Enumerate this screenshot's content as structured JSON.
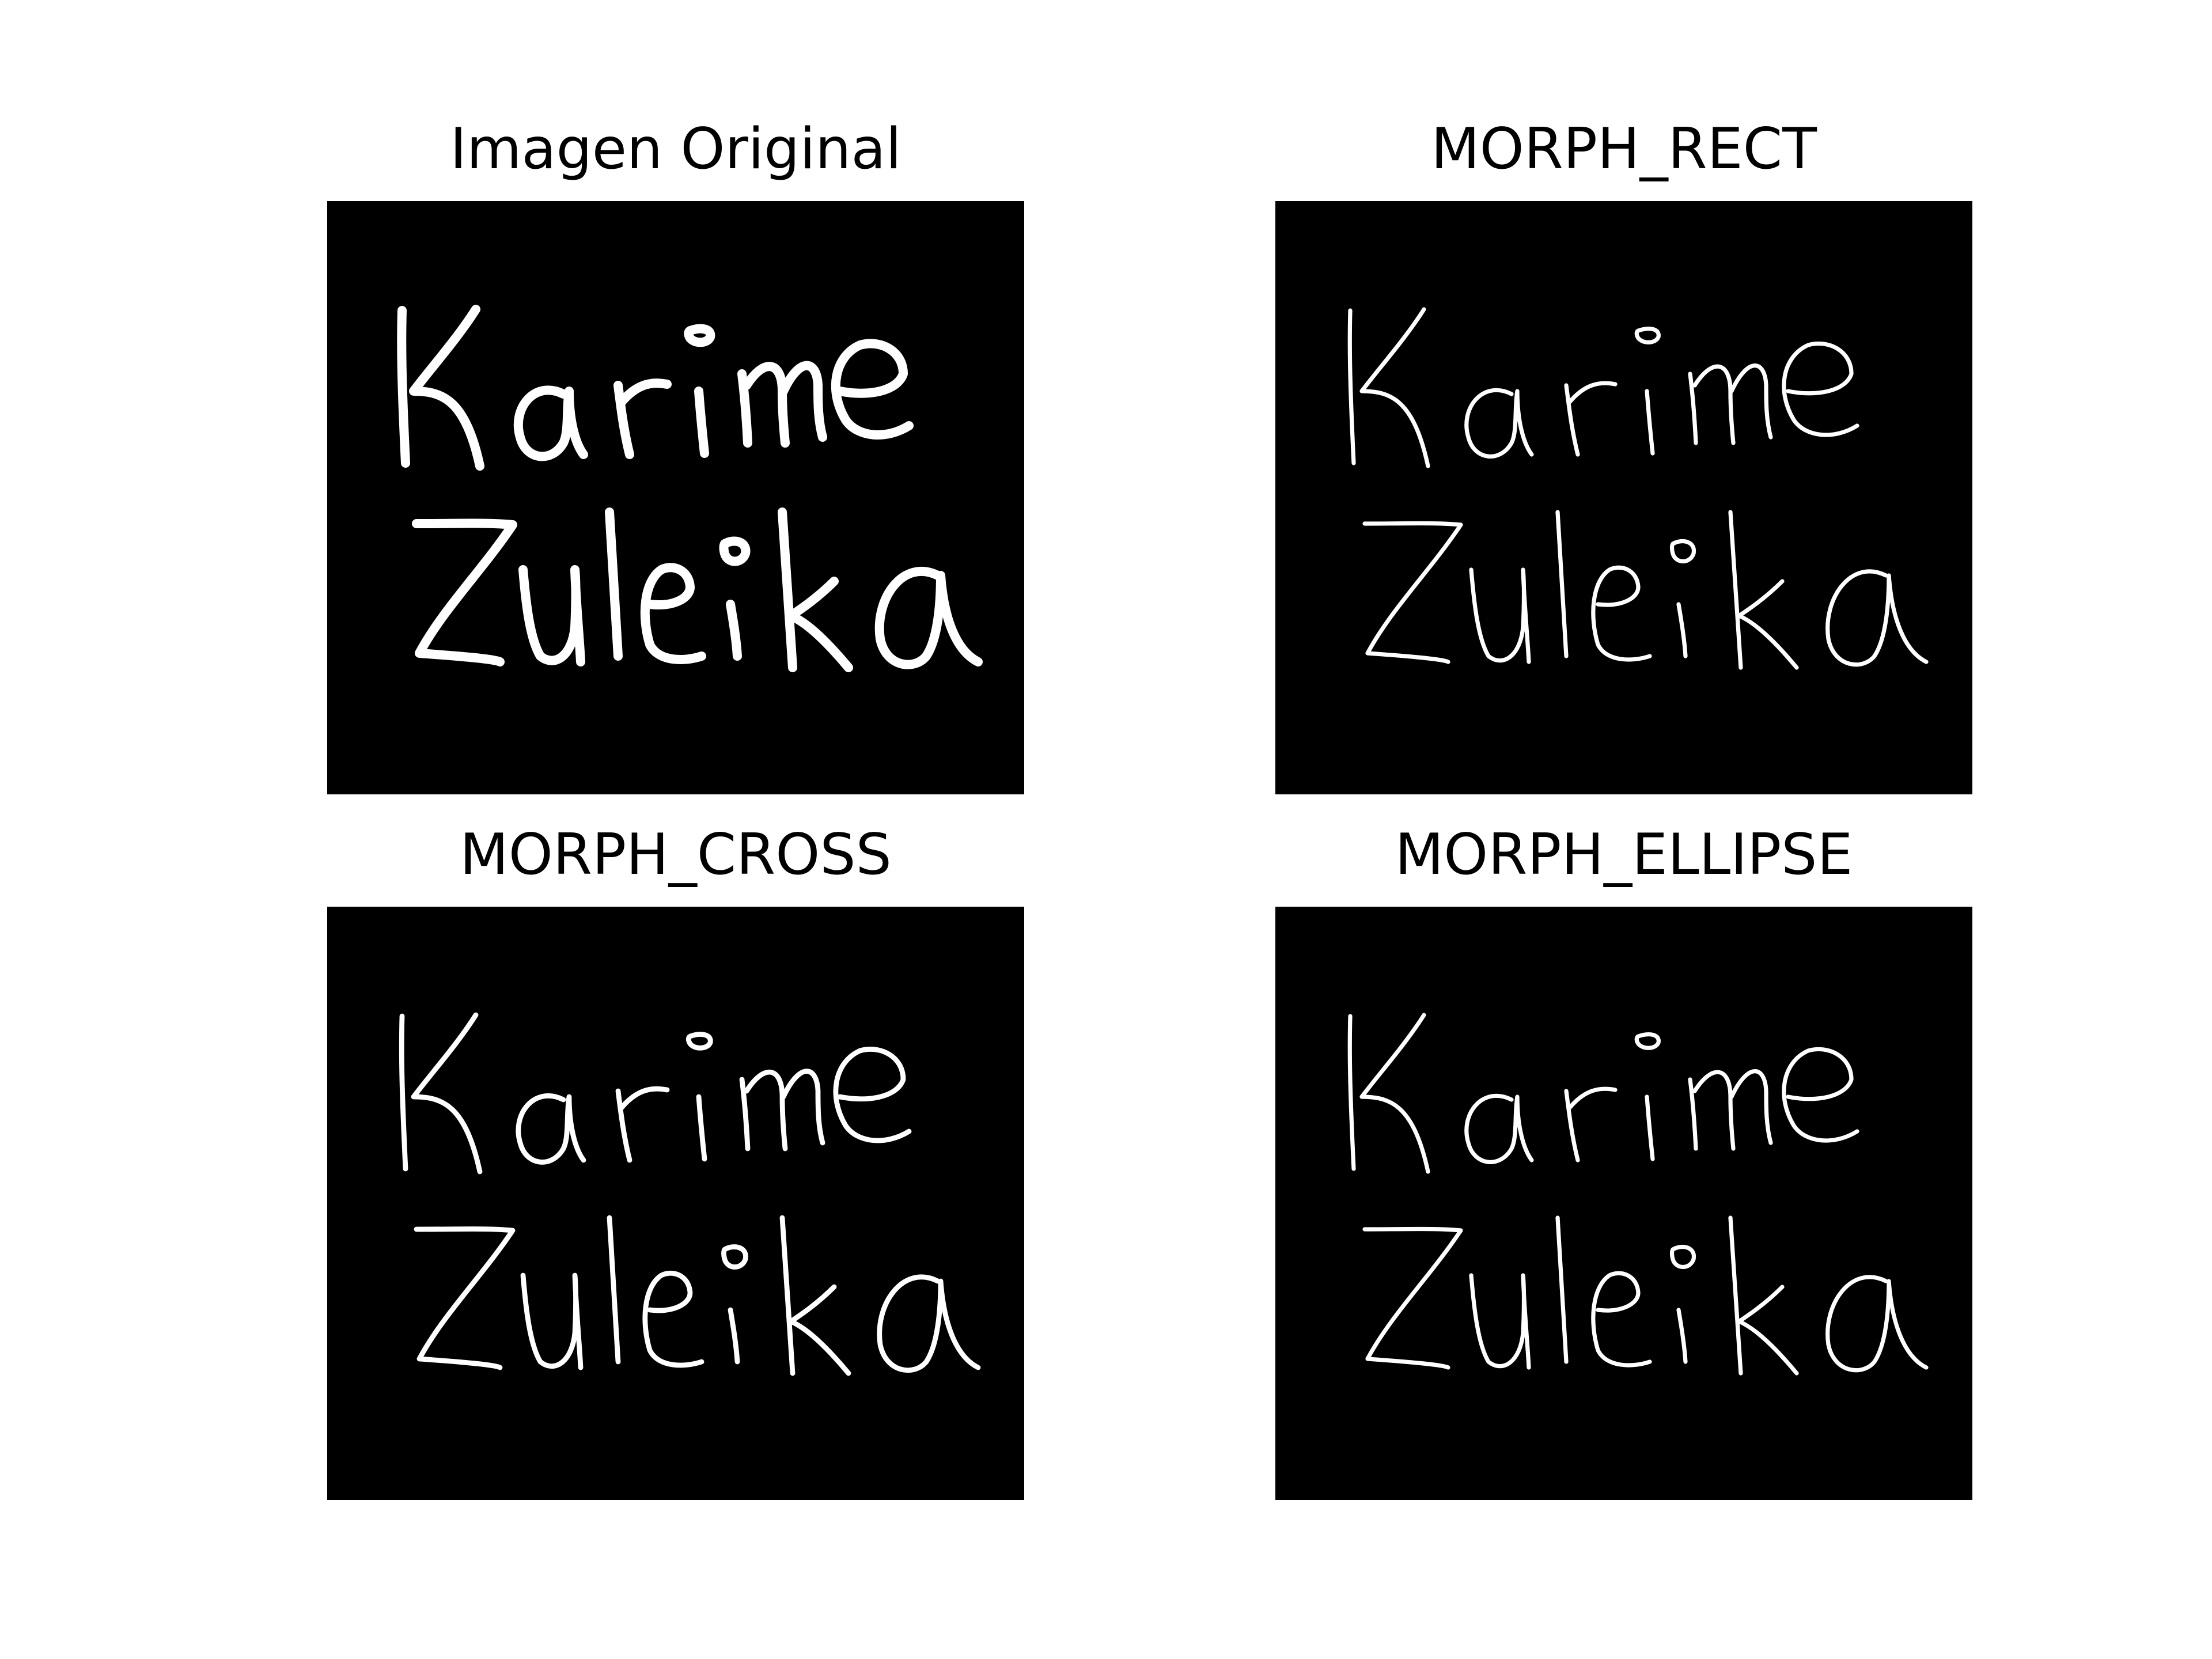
{
  "figure": {
    "panels": [
      {
        "title": "Imagen Original",
        "stroke_weight": 1.0
      },
      {
        "title": "MORPH_RECT",
        "stroke_weight": 0.45
      },
      {
        "title": "MORPH_CROSS",
        "stroke_weight": 0.55
      },
      {
        "title": "MORPH_ELLIPSE",
        "stroke_weight": 0.45
      }
    ],
    "handwriting": {
      "line1": "Karime",
      "line2": "Zuleika"
    },
    "colors": {
      "background": "#ffffff",
      "image_background": "#000000",
      "ink": "#ffffff",
      "title_text": "#000000"
    }
  }
}
